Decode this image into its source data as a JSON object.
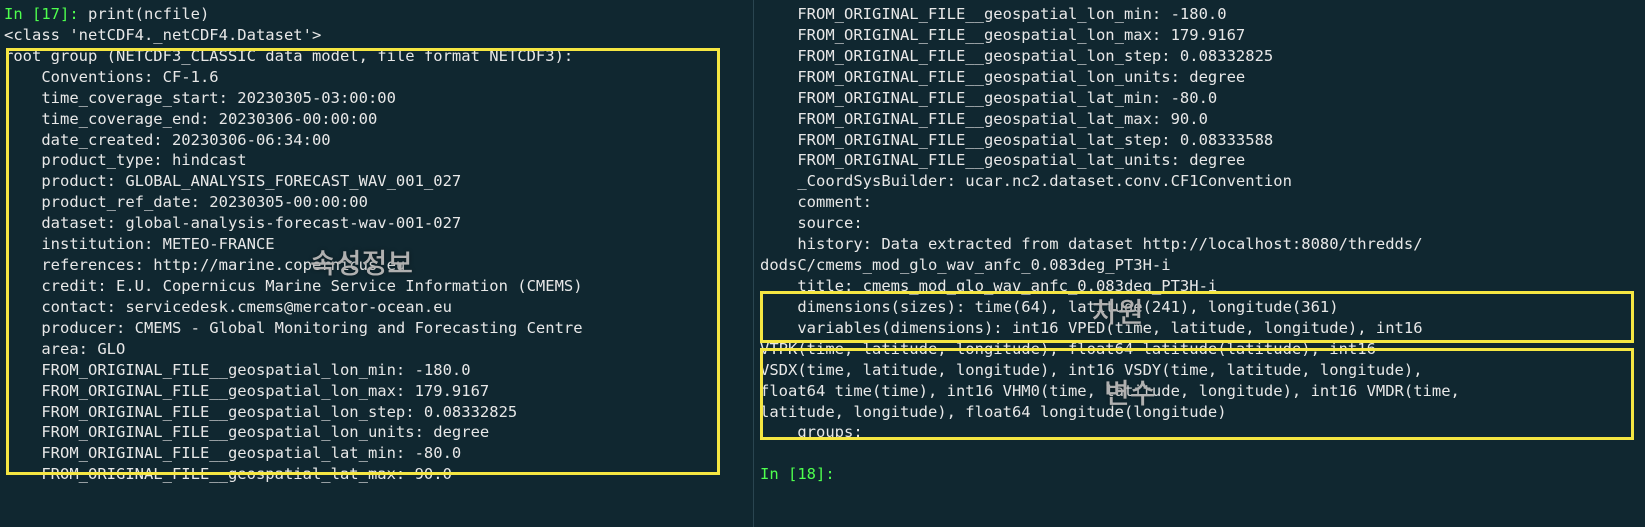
{
  "left": {
    "prompt_in": "In ",
    "prompt_num": "[17]",
    "prompt_colon": ": ",
    "code": "print(ncfile)",
    "output_lines": [
      "<class 'netCDF4._netCDF4.Dataset'>",
      "root group (NETCDF3_CLASSIC data model, file format NETCDF3):",
      "    Conventions: CF-1.6",
      "    time_coverage_start: 20230305-03:00:00",
      "    time_coverage_end: 20230306-00:00:00",
      "    date_created: 20230306-06:34:00",
      "    product_type: hindcast",
      "    product: GLOBAL_ANALYSIS_FORECAST_WAV_001_027",
      "    product_ref_date: 20230305-00:00:00",
      "    dataset: global-analysis-forecast-wav-001-027",
      "    institution: METEO-FRANCE",
      "    references: http://marine.copernicus.eu",
      "    credit: E.U. Copernicus Marine Service Information (CMEMS)",
      "    contact: servicedesk.cmems@mercator-ocean.eu",
      "    producer: CMEMS - Global Monitoring and Forecasting Centre",
      "    area: GLO",
      "    FROM_ORIGINAL_FILE__geospatial_lon_min: -180.0",
      "    FROM_ORIGINAL_FILE__geospatial_lon_max: 179.9167",
      "    FROM_ORIGINAL_FILE__geospatial_lon_step: 0.08332825",
      "    FROM_ORIGINAL_FILE__geospatial_lon_units: degree",
      "    FROM_ORIGINAL_FILE__geospatial_lat_min: -80.0",
      "    FROM_ORIGINAL_FILE__geospatial_lat_max: 90.0"
    ]
  },
  "right": {
    "output_lines": [
      "    FROM_ORIGINAL_FILE__geospatial_lon_min: -180.0",
      "    FROM_ORIGINAL_FILE__geospatial_lon_max: 179.9167",
      "    FROM_ORIGINAL_FILE__geospatial_lon_step: 0.08332825",
      "    FROM_ORIGINAL_FILE__geospatial_lon_units: degree",
      "    FROM_ORIGINAL_FILE__geospatial_lat_min: -80.0",
      "    FROM_ORIGINAL_FILE__geospatial_lat_max: 90.0",
      "    FROM_ORIGINAL_FILE__geospatial_lat_step: 0.08333588",
      "    FROM_ORIGINAL_FILE__geospatial_lat_units: degree",
      "    _CoordSysBuilder: ucar.nc2.dataset.conv.CF1Convention",
      "    comment:",
      "    source:",
      "    history: Data extracted from dataset http://localhost:8080/thredds/",
      "dodsC/cmems_mod_glo_wav_anfc_0.083deg_PT3H-i",
      "    title: cmems_mod_glo_wav_anfc_0.083deg_PT3H-i",
      "    dimensions(sizes): time(64), latitude(241), longitude(361)",
      "    variables(dimensions): int16 VPED(time, latitude, longitude), int16",
      "VTPK(time, latitude, longitude), float64 latitude(latitude), int16",
      "VSDX(time, latitude, longitude), int16 VSDY(time, latitude, longitude),",
      "float64 time(time), int16 VHM0(time, latitude, longitude), int16 VMDR(time,",
      "latitude, longitude), float64 longitude(longitude)",
      "    groups:"
    ],
    "prompt_in": "In ",
    "prompt_num": "[18]",
    "prompt_colon": ": "
  },
  "annotations": {
    "attributes": "속성정보",
    "dimensions": "차원",
    "variables": "변수"
  }
}
